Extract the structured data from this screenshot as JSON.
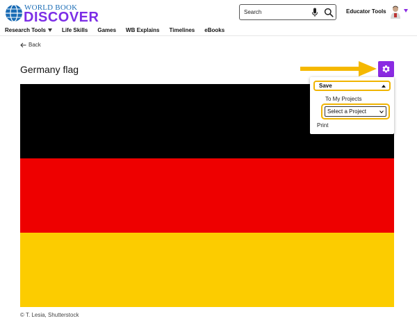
{
  "header": {
    "logo_top": "WORLD BOOK",
    "logo_main": "DISCOVER",
    "search_placeholder": "Search",
    "educator_tools": "Educator Tools"
  },
  "nav": {
    "items": [
      {
        "label": "Research Tools",
        "has_caret": true
      },
      {
        "label": "Life Skills"
      },
      {
        "label": "Games"
      },
      {
        "label": "WB Explains"
      },
      {
        "label": "Timelines"
      },
      {
        "label": "eBooks"
      }
    ]
  },
  "back_label": "Back",
  "page_title": "Germany flag",
  "flag": {
    "stripe_colors": [
      "#000000",
      "#ee0000",
      "#fccc00"
    ]
  },
  "credit": "© T. Lesia, Shutterstock",
  "settings_menu": {
    "save_label": "Save",
    "to_projects_label": "To My Projects",
    "project_select_value": "Select a Project",
    "print_label": "Print"
  },
  "colors": {
    "brand_purple": "#8a2be2",
    "highlight": "#f0b400",
    "logo_blue": "#1a6cb5"
  },
  "icons": [
    "globe-logo-icon",
    "microphone-icon",
    "search-icon",
    "chevron-down-icon",
    "back-arrow-icon",
    "gear-icon",
    "chevron-up-icon"
  ]
}
